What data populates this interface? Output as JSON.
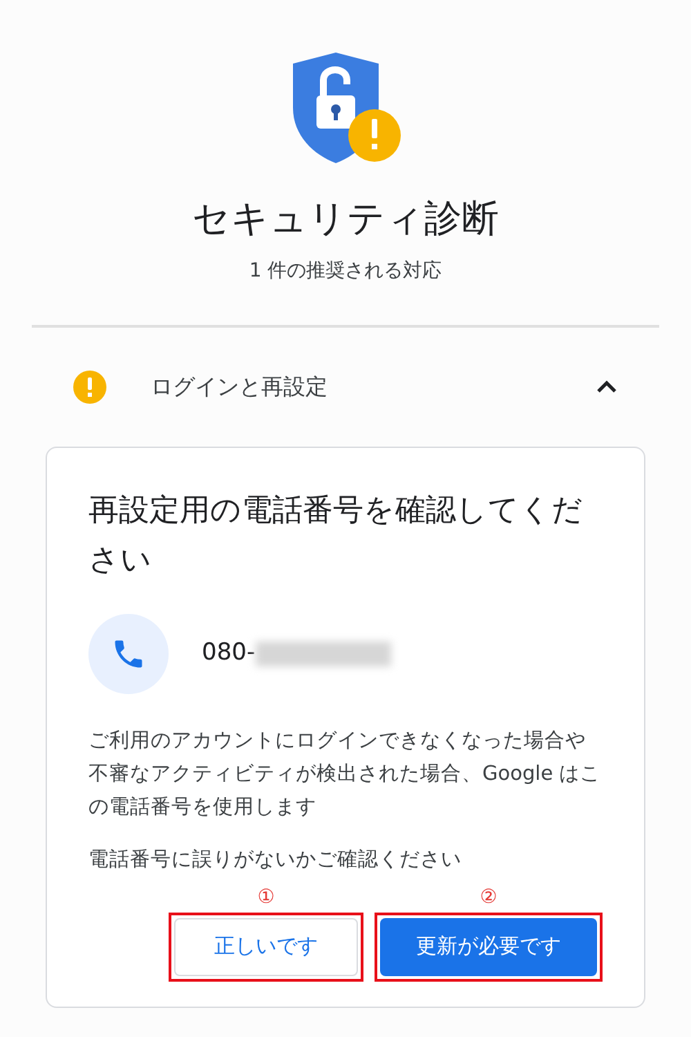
{
  "header": {
    "title": "セキュリティ診断",
    "subtitle": "1 件の推奨される対応"
  },
  "section": {
    "title": "ログインと再設定",
    "expanded": true,
    "card": {
      "title": "再設定用の電話番号を確認してください",
      "phone": "080-",
      "description": "ご利用のアカウントにログインできなくなった場合や不審なアクティビティが検出された場合、Google はこの電話番号を使用します",
      "prompt": "電話番号に誤りがないかご確認ください",
      "buttons": [
        {
          "label": "正しいです",
          "kind": "outlined",
          "annotation": "①"
        },
        {
          "label": "更新が必要です",
          "kind": "filled",
          "annotation": "②"
        }
      ]
    }
  }
}
